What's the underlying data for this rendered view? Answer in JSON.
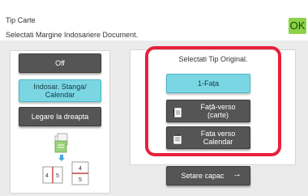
{
  "header": {
    "title": "Tip Carte",
    "subtitle": "Selectati Margine Indosariere Document.",
    "ok_label": "OK"
  },
  "left_options": [
    {
      "label": "Off",
      "selected": false
    },
    {
      "label": "Indosar. Stanga/ Calendar",
      "selected": true
    },
    {
      "label": "Legare la dreapta",
      "selected": false
    }
  ],
  "original_type": {
    "prompt": "Selectati Tip Original.",
    "options": [
      {
        "label": "1-Fața",
        "selected": true,
        "icon": "single-sided-icon"
      },
      {
        "label": "Față-verso (carte)",
        "selected": false,
        "icon": "book-duplex-icon"
      },
      {
        "label": "Fata verso Calendar",
        "selected": false,
        "icon": "calendar-duplex-icon"
      }
    ]
  },
  "footer": {
    "cover_button_label": "Setare capac",
    "cover_button_icon": "arrow-right-icon"
  },
  "illustration": {
    "page_numbers_left": [
      "4",
      "5"
    ],
    "page_numbers_right": [
      "4",
      "5"
    ]
  },
  "colors": {
    "selected_button": "#7bd6e4",
    "dark_button": "#555555",
    "ok_button": "#8bd248",
    "highlight_frame": "#e8203c"
  }
}
